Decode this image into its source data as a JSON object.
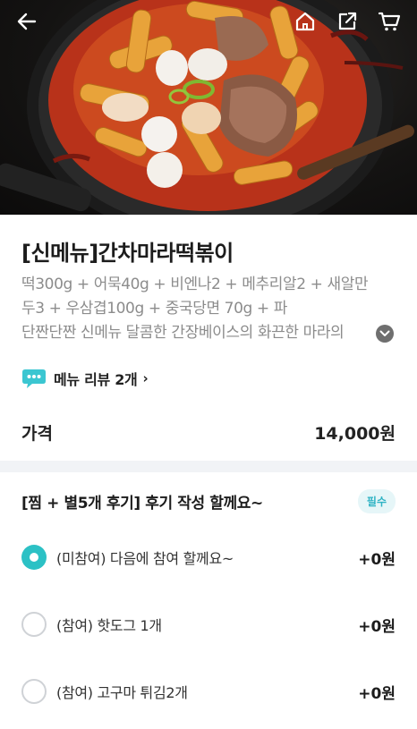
{
  "header": {
    "back_icon": "arrow-left-icon",
    "home_icon": "home-icon",
    "share_icon": "share-icon",
    "cart_icon": "cart-icon"
  },
  "menu": {
    "title": "[신메뉴]간차마라떡볶이",
    "description_lines": [
      "떡300g + 어묵40g + 비엔나2 + 메추리알2 + 새알만",
      "두3 + 우삼겹100g + 중국당면 70g + 파",
      "단짠단짠 신메뉴 달콤한 간장베이스의 화끈한 마라의"
    ],
    "review_link": "메뉴 리뷰 2개",
    "price_label": "가격",
    "price_value": "14,000원"
  },
  "options": {
    "title": "[찜 + 별5개 후기] 후기 작성 할께요~",
    "required_badge": "필수",
    "items": [
      {
        "label": "(미참여) 다음에 참여 할께요~",
        "price": "+0원",
        "selected": true
      },
      {
        "label": "(참여) 핫도그 1개",
        "price": "+0원",
        "selected": false
      },
      {
        "label": "(참여) 고구마 튀김2개",
        "price": "+0원",
        "selected": false
      }
    ]
  },
  "colors": {
    "accent": "#2cc1c5",
    "badge_text": "#2fb3c4",
    "muted_text": "#8c8c8c"
  }
}
